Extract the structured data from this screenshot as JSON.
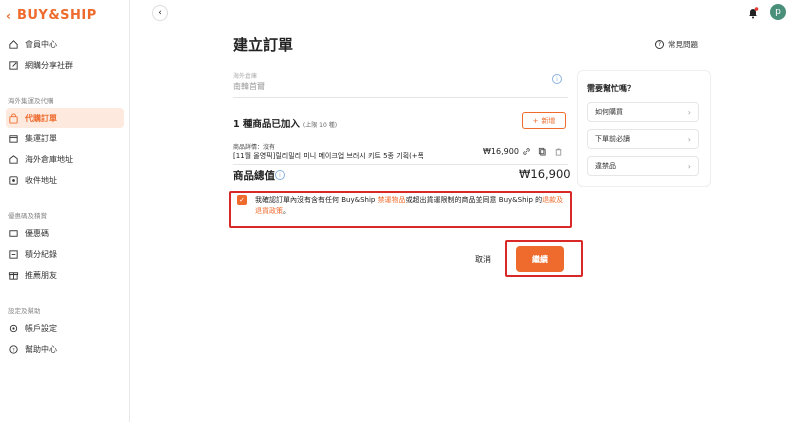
{
  "brand": {
    "logo_text": "BUY&SHIP",
    "accent": "#ee6b2d"
  },
  "sidebar": {
    "items_top": [
      {
        "label": "會員中心",
        "icon": "home-icon"
      },
      {
        "label": "網購分享社群",
        "icon": "edit-icon"
      }
    ],
    "section1_label": "海外集運及代購",
    "items_section1": [
      {
        "label": "代購訂單",
        "icon": "bag-icon",
        "active": true
      },
      {
        "label": "集運訂單",
        "icon": "package-icon"
      },
      {
        "label": "海外倉庫地址",
        "icon": "warehouse-icon"
      },
      {
        "label": "收件地址",
        "icon": "location-icon"
      }
    ],
    "section2_label": "優惠碼及積賞",
    "items_section2": [
      {
        "label": "優惠碼",
        "icon": "ticket-icon"
      },
      {
        "label": "積分紀錄",
        "icon": "points-icon"
      },
      {
        "label": "推薦朋友",
        "icon": "gift-icon"
      }
    ],
    "section3_label": "設定及幫助",
    "items_section3": [
      {
        "label": "帳戶設定",
        "icon": "gear-icon"
      },
      {
        "label": "幫助中心",
        "icon": "help-icon"
      }
    ]
  },
  "header": {
    "avatar_letter": "p"
  },
  "main": {
    "title": "建立訂單",
    "faq_label": "常見問題",
    "warehouse_label": "海外倉庫",
    "warehouse_value": "南韓首爾",
    "items_count": "1 種商品已加入",
    "items_limit": "(上限 10 種)",
    "add_label": "新增",
    "item_detail": "商品詳情：沒有",
    "item_name": "[11월 올영픽]릴리밀리 미니 메이크업 브러시 키트 5종 기획(+폭닥...",
    "item_price": "₩16,900",
    "total_label": "商品總值",
    "total_value": "₩16,900",
    "confirm_part1": "我確認訂單內沒有含有任何 Buy&Ship ",
    "confirm_link1": "禁運物品",
    "confirm_part2": "或超出貨運限制的商品並同意 Buy&Ship 的",
    "confirm_link2": "退款及退貨政策",
    "confirm_end": "。",
    "cancel_label": "取消",
    "continue_label": "繼續"
  },
  "help": {
    "title": "需要幫忙嗎？",
    "items": [
      "如何購買",
      "下單前必讀",
      "違禁品"
    ]
  }
}
